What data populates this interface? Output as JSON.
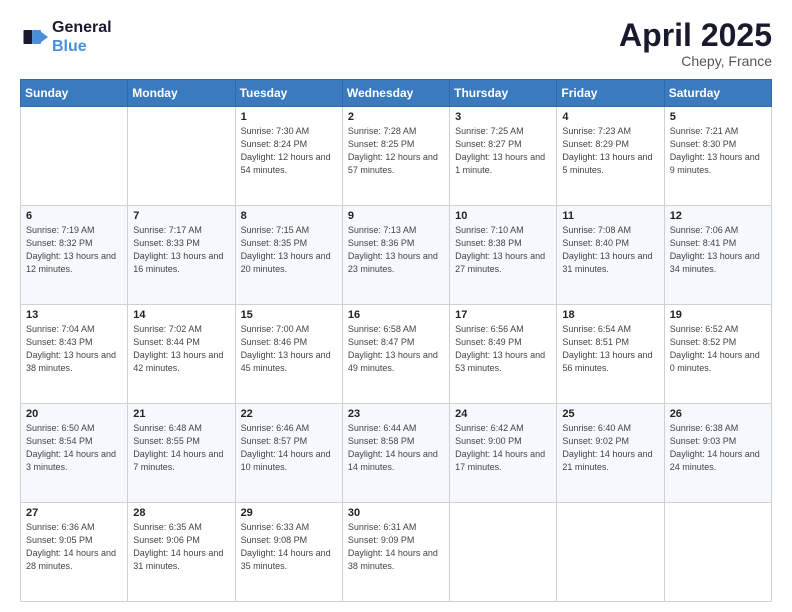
{
  "header": {
    "logo_line1": "General",
    "logo_line2": "Blue",
    "month_title": "April 2025",
    "location": "Chepy, France"
  },
  "days_of_week": [
    "Sunday",
    "Monday",
    "Tuesday",
    "Wednesday",
    "Thursday",
    "Friday",
    "Saturday"
  ],
  "weeks": [
    [
      {
        "day": "",
        "info": ""
      },
      {
        "day": "",
        "info": ""
      },
      {
        "day": "1",
        "info": "Sunrise: 7:30 AM\nSunset: 8:24 PM\nDaylight: 12 hours\nand 54 minutes."
      },
      {
        "day": "2",
        "info": "Sunrise: 7:28 AM\nSunset: 8:25 PM\nDaylight: 12 hours\nand 57 minutes."
      },
      {
        "day": "3",
        "info": "Sunrise: 7:25 AM\nSunset: 8:27 PM\nDaylight: 13 hours\nand 1 minute."
      },
      {
        "day": "4",
        "info": "Sunrise: 7:23 AM\nSunset: 8:29 PM\nDaylight: 13 hours\nand 5 minutes."
      },
      {
        "day": "5",
        "info": "Sunrise: 7:21 AM\nSunset: 8:30 PM\nDaylight: 13 hours\nand 9 minutes."
      }
    ],
    [
      {
        "day": "6",
        "info": "Sunrise: 7:19 AM\nSunset: 8:32 PM\nDaylight: 13 hours\nand 12 minutes."
      },
      {
        "day": "7",
        "info": "Sunrise: 7:17 AM\nSunset: 8:33 PM\nDaylight: 13 hours\nand 16 minutes."
      },
      {
        "day": "8",
        "info": "Sunrise: 7:15 AM\nSunset: 8:35 PM\nDaylight: 13 hours\nand 20 minutes."
      },
      {
        "day": "9",
        "info": "Sunrise: 7:13 AM\nSunset: 8:36 PM\nDaylight: 13 hours\nand 23 minutes."
      },
      {
        "day": "10",
        "info": "Sunrise: 7:10 AM\nSunset: 8:38 PM\nDaylight: 13 hours\nand 27 minutes."
      },
      {
        "day": "11",
        "info": "Sunrise: 7:08 AM\nSunset: 8:40 PM\nDaylight: 13 hours\nand 31 minutes."
      },
      {
        "day": "12",
        "info": "Sunrise: 7:06 AM\nSunset: 8:41 PM\nDaylight: 13 hours\nand 34 minutes."
      }
    ],
    [
      {
        "day": "13",
        "info": "Sunrise: 7:04 AM\nSunset: 8:43 PM\nDaylight: 13 hours\nand 38 minutes."
      },
      {
        "day": "14",
        "info": "Sunrise: 7:02 AM\nSunset: 8:44 PM\nDaylight: 13 hours\nand 42 minutes."
      },
      {
        "day": "15",
        "info": "Sunrise: 7:00 AM\nSunset: 8:46 PM\nDaylight: 13 hours\nand 45 minutes."
      },
      {
        "day": "16",
        "info": "Sunrise: 6:58 AM\nSunset: 8:47 PM\nDaylight: 13 hours\nand 49 minutes."
      },
      {
        "day": "17",
        "info": "Sunrise: 6:56 AM\nSunset: 8:49 PM\nDaylight: 13 hours\nand 53 minutes."
      },
      {
        "day": "18",
        "info": "Sunrise: 6:54 AM\nSunset: 8:51 PM\nDaylight: 13 hours\nand 56 minutes."
      },
      {
        "day": "19",
        "info": "Sunrise: 6:52 AM\nSunset: 8:52 PM\nDaylight: 14 hours\nand 0 minutes."
      }
    ],
    [
      {
        "day": "20",
        "info": "Sunrise: 6:50 AM\nSunset: 8:54 PM\nDaylight: 14 hours\nand 3 minutes."
      },
      {
        "day": "21",
        "info": "Sunrise: 6:48 AM\nSunset: 8:55 PM\nDaylight: 14 hours\nand 7 minutes."
      },
      {
        "day": "22",
        "info": "Sunrise: 6:46 AM\nSunset: 8:57 PM\nDaylight: 14 hours\nand 10 minutes."
      },
      {
        "day": "23",
        "info": "Sunrise: 6:44 AM\nSunset: 8:58 PM\nDaylight: 14 hours\nand 14 minutes."
      },
      {
        "day": "24",
        "info": "Sunrise: 6:42 AM\nSunset: 9:00 PM\nDaylight: 14 hours\nand 17 minutes."
      },
      {
        "day": "25",
        "info": "Sunrise: 6:40 AM\nSunset: 9:02 PM\nDaylight: 14 hours\nand 21 minutes."
      },
      {
        "day": "26",
        "info": "Sunrise: 6:38 AM\nSunset: 9:03 PM\nDaylight: 14 hours\nand 24 minutes."
      }
    ],
    [
      {
        "day": "27",
        "info": "Sunrise: 6:36 AM\nSunset: 9:05 PM\nDaylight: 14 hours\nand 28 minutes."
      },
      {
        "day": "28",
        "info": "Sunrise: 6:35 AM\nSunset: 9:06 PM\nDaylight: 14 hours\nand 31 minutes."
      },
      {
        "day": "29",
        "info": "Sunrise: 6:33 AM\nSunset: 9:08 PM\nDaylight: 14 hours\nand 35 minutes."
      },
      {
        "day": "30",
        "info": "Sunrise: 6:31 AM\nSunset: 9:09 PM\nDaylight: 14 hours\nand 38 minutes."
      },
      {
        "day": "",
        "info": ""
      },
      {
        "day": "",
        "info": ""
      },
      {
        "day": "",
        "info": ""
      }
    ]
  ]
}
